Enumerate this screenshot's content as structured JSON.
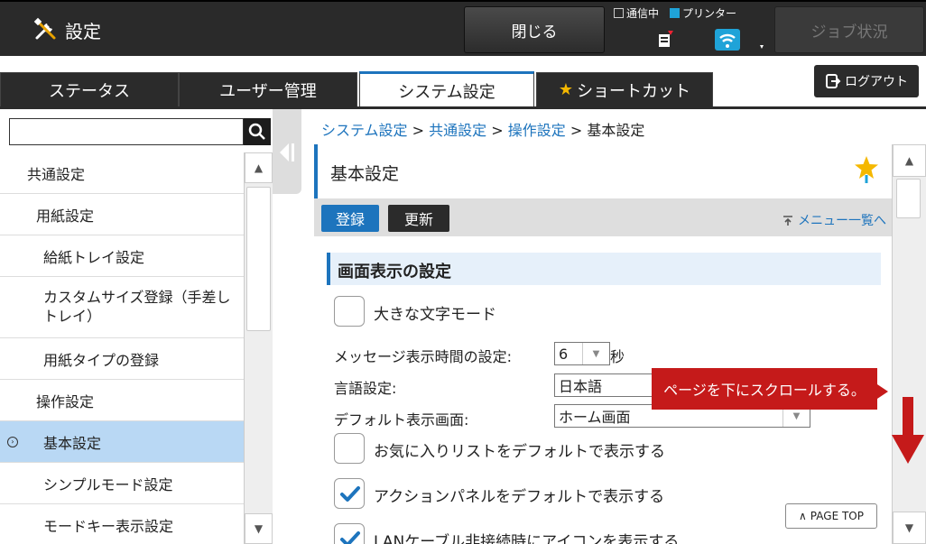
{
  "header": {
    "title": "設定",
    "title_icon": "tools-icon",
    "close_label": "閉じる",
    "status_comm": "通信中",
    "status_printer": "プリンター",
    "job_status_label": "ジョブ状況",
    "accent_color": "#1d74bd"
  },
  "tabs": [
    {
      "label": "ステータス"
    },
    {
      "label": "ユーザー管理"
    },
    {
      "label": "システム設定",
      "active": true
    },
    {
      "label": "ショートカット",
      "icon": "star-icon"
    }
  ],
  "logout_label": "ログアウト",
  "sidebar": {
    "search_placeholder": "",
    "items": [
      {
        "label": "共通設定"
      },
      {
        "label": "用紙設定"
      },
      {
        "label": "給紙トレイ設定"
      },
      {
        "label": "カスタムサイズ登録（手差しトレイ）"
      },
      {
        "label": "用紙タイプの登録"
      },
      {
        "label": "操作設定"
      },
      {
        "label": "基本設定",
        "selected": true
      },
      {
        "label": "シンプルモード設定"
      },
      {
        "label": "モードキー表示設定"
      }
    ]
  },
  "breadcrumb": {
    "items": [
      "システム設定",
      "共通設定",
      "操作設定",
      "基本設定"
    ],
    "separator": ">"
  },
  "page": {
    "title": "基本設定",
    "register_label": "登録",
    "update_label": "更新",
    "menu_list_label": "メニュー一覧へ",
    "section_title": "画面表示の設定",
    "large_font_label": "大きな文字モード",
    "msg_time_label": "メッセージ表示時間の設定:",
    "msg_time_value": "6",
    "msg_time_unit": "秒",
    "language_label": "言語設定:",
    "language_value": "日本語",
    "default_screen_label": "デフォルト表示画面:",
    "default_screen_value": "ホーム画面",
    "favorites_label": "お気に入りリストをデフォルトで表示する",
    "action_panel_label": "アクションパネルをデフォルトで表示する",
    "lan_icon_label": "LANケーブル非接続時にアイコンを表示する",
    "page_top_label": "PAGE TOP"
  },
  "annotation": {
    "text": "ページを下にスクロールする。",
    "color": "#c51a1a"
  }
}
